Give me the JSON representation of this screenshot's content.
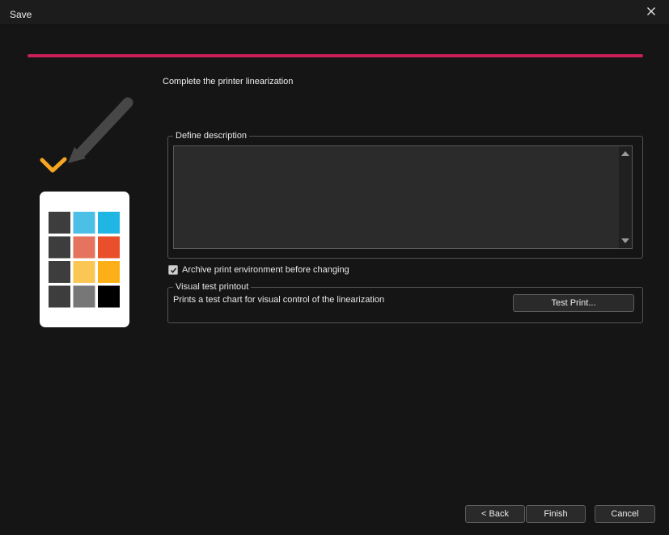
{
  "window": {
    "title": "Save"
  },
  "progress": {
    "color": "#c81e5a",
    "fraction": 1.0
  },
  "page": {
    "heading": "Complete the printer linearization"
  },
  "illustration": {
    "icon": "color-patch-chart-with-pen-checkmark-icon",
    "swatch_colors": [
      "#3d3d3d",
      "#4cbfe6",
      "#1fb6e3",
      "#3d3d3d",
      "#e5735e",
      "#e84f2a",
      "#3d3d3d",
      "#fbc754",
      "#fcaf17",
      "#3d3d3d",
      "#777777",
      "#000000"
    ],
    "check_color": "#f5a623"
  },
  "description_group": {
    "legend": "Define description",
    "value": "",
    "placeholder": ""
  },
  "archive_option": {
    "label": "Archive print environment before changing",
    "checked": true
  },
  "visual_group": {
    "legend": "Visual test printout",
    "description": "Prints a test chart for visual control of the linearization",
    "button_label": "Test Print..."
  },
  "footer": {
    "back_label": "< Back",
    "finish_label": "Finish",
    "cancel_label": "Cancel"
  }
}
